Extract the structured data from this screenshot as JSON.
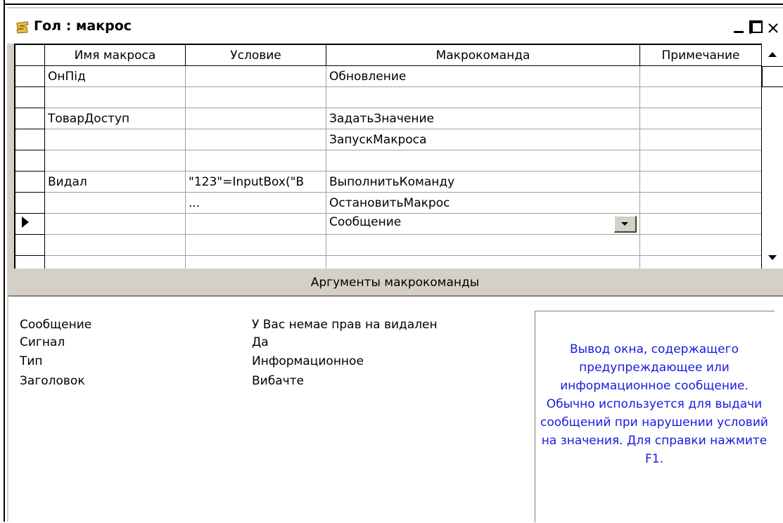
{
  "window": {
    "title": "Гол : макрос",
    "minimize_glyph": "_",
    "close_glyph": "×"
  },
  "grid": {
    "columns": [
      "Имя макроса",
      "Условие",
      "Макрокоманда",
      "Примечание"
    ],
    "rows": [
      {
        "name": "ОнПід",
        "condition": "",
        "action": "Обновление",
        "note": "",
        "current": false
      },
      {
        "name": "",
        "condition": "",
        "action": "",
        "note": "",
        "current": false
      },
      {
        "name": "ТоварДоступ",
        "condition": "",
        "action": "ЗадатьЗначение",
        "note": "",
        "current": false
      },
      {
        "name": "",
        "condition": "",
        "action": "ЗапускМакроса",
        "note": "",
        "current": false
      },
      {
        "name": "",
        "condition": "",
        "action": "",
        "note": "",
        "current": false
      },
      {
        "name": "Видал",
        "condition": "\"123\"=InputBox(\"В",
        "action": "ВыполнитьКоманду",
        "note": "",
        "current": false
      },
      {
        "name": "",
        "condition": "...",
        "action": "ОстановитьМакрос",
        "note": "",
        "current": false
      },
      {
        "name": "",
        "condition": "",
        "action": "Сообщение",
        "note": "",
        "current": true
      },
      {
        "name": "",
        "condition": "",
        "action": "",
        "note": "",
        "current": false
      },
      {
        "name": "",
        "condition": "",
        "action": "",
        "note": "",
        "current": false
      }
    ]
  },
  "arguments": {
    "header": "Аргументы макрокоманды",
    "items": [
      {
        "label": "Сообщение",
        "value": "У Вас немае прав на видален"
      },
      {
        "label": "Сигнал",
        "value": "Да"
      },
      {
        "label": "Тип",
        "value": "Информационное"
      },
      {
        "label": "Заголовок",
        "value": "Вибачте"
      }
    ],
    "help": "Вывод окна, содержащего предупреждающее или информационное сообщение. Обычно используется для выдачи сообщений при нарушении условий на значения. Для справки нажмите F1."
  },
  "colors": {
    "help_text": "#1a1ae0",
    "panel_gray": "#d4d0c8"
  }
}
